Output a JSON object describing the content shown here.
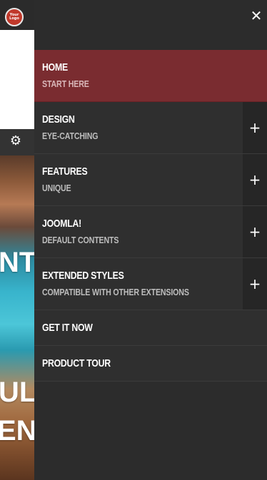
{
  "background": {
    "logo_text": "Your\nLogo",
    "hero_lines": [
      "NT",
      "UL",
      "ENT"
    ]
  },
  "menu": {
    "close_icon": "close-icon",
    "items": [
      {
        "title": "HOME",
        "subtitle": "START HERE",
        "active": true,
        "expandable": false
      },
      {
        "title": "DESIGN",
        "subtitle": "EYE-CATCHING",
        "active": false,
        "expandable": true
      },
      {
        "title": "FEATURES",
        "subtitle": "UNIQUE",
        "active": false,
        "expandable": true
      },
      {
        "title": "JOOMLA!",
        "subtitle": "DEFAULT CONTENTS",
        "active": false,
        "expandable": true
      },
      {
        "title": "EXTENDED STYLES",
        "subtitle": "COMPATIBLE WITH OTHER EXTENSIONS",
        "active": false,
        "expandable": true
      },
      {
        "title": "GET IT NOW",
        "subtitle": "",
        "active": false,
        "expandable": false
      },
      {
        "title": "PRODUCT TOUR",
        "subtitle": "",
        "active": false,
        "expandable": false
      }
    ],
    "toggle_label": "+",
    "close_label": "✕"
  },
  "colors": {
    "menu_bg": "#2c2c2c",
    "active_bg": "#7a2c30",
    "toggle_bg": "#262626",
    "logo": "#c0392b"
  }
}
